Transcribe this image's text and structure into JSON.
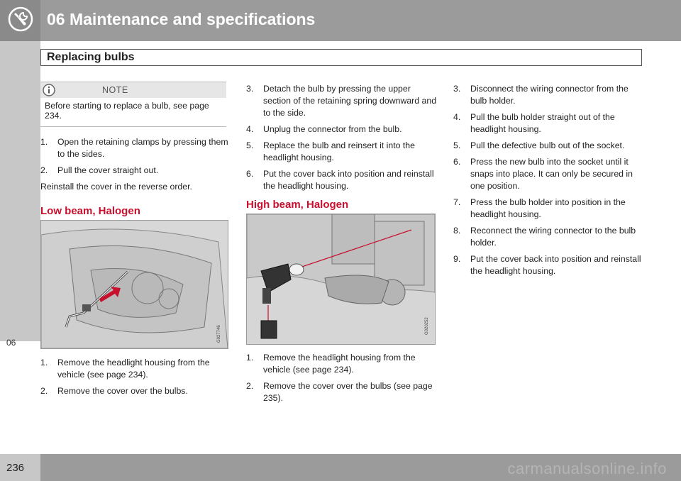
{
  "header": {
    "chapter_title": "06 Maintenance and specifications",
    "icon": "wrench-gear-icon"
  },
  "side_tab": {
    "label": "06"
  },
  "section": {
    "title": "Replacing bulbs"
  },
  "note": {
    "label": "NOTE",
    "icon": "info-icon",
    "text": "Before starting to replace a bulb, see page 234."
  },
  "col1": {
    "steps": [
      {
        "num": "1.",
        "text": "Open the retaining clamps by pressing them to the sides."
      },
      {
        "num": "2.",
        "text": "Pull the cover straight out."
      }
    ],
    "reinstall": "Reinstall the cover in the reverse order.",
    "low_beam": {
      "heading": "Low beam, Halogen",
      "figure_code": "G027746",
      "steps": [
        {
          "num": "1.",
          "text": "Remove the headlight housing from the vehicle (see page 234)."
        },
        {
          "num": "2.",
          "text": "Remove the cover over the bulbs."
        }
      ]
    }
  },
  "col2": {
    "steps": [
      {
        "num": "3.",
        "text": "Detach the bulb by pressing the upper section of the retaining spring downward and to the side."
      },
      {
        "num": "4.",
        "text": "Unplug the connector from the bulb."
      },
      {
        "num": "5.",
        "text": "Replace the bulb and reinsert it into the headlight housing."
      },
      {
        "num": "6.",
        "text": "Put the cover back into position and reinstall the headlight housing."
      }
    ],
    "high_beam": {
      "heading": "High beam, Halogen",
      "figure_code": "G020252",
      "steps": [
        {
          "num": "1.",
          "text": "Remove the headlight housing from the vehicle (see page 234)."
        },
        {
          "num": "2.",
          "text": "Remove the cover over the bulbs (see page 235)."
        }
      ]
    }
  },
  "col3": {
    "steps": [
      {
        "num": "3.",
        "text": "Disconnect the wiring connector from the bulb holder."
      },
      {
        "num": "4.",
        "text": "Pull the bulb holder straight out of the headlight housing."
      },
      {
        "num": "5.",
        "text": "Pull the defective bulb out of the socket."
      },
      {
        "num": "6.",
        "text": "Press the new bulb into the socket until it snaps into place. It can only be secured in one position."
      },
      {
        "num": "7.",
        "text": "Press the bulb holder into position in the headlight housing."
      },
      {
        "num": "8.",
        "text": "Reconnect the wiring connector to the bulb holder."
      },
      {
        "num": "9.",
        "text": "Put the cover back into position and reinstall the headlight housing."
      }
    ]
  },
  "footer": {
    "page_number": "236",
    "watermark": "carmanualsonline.info"
  }
}
